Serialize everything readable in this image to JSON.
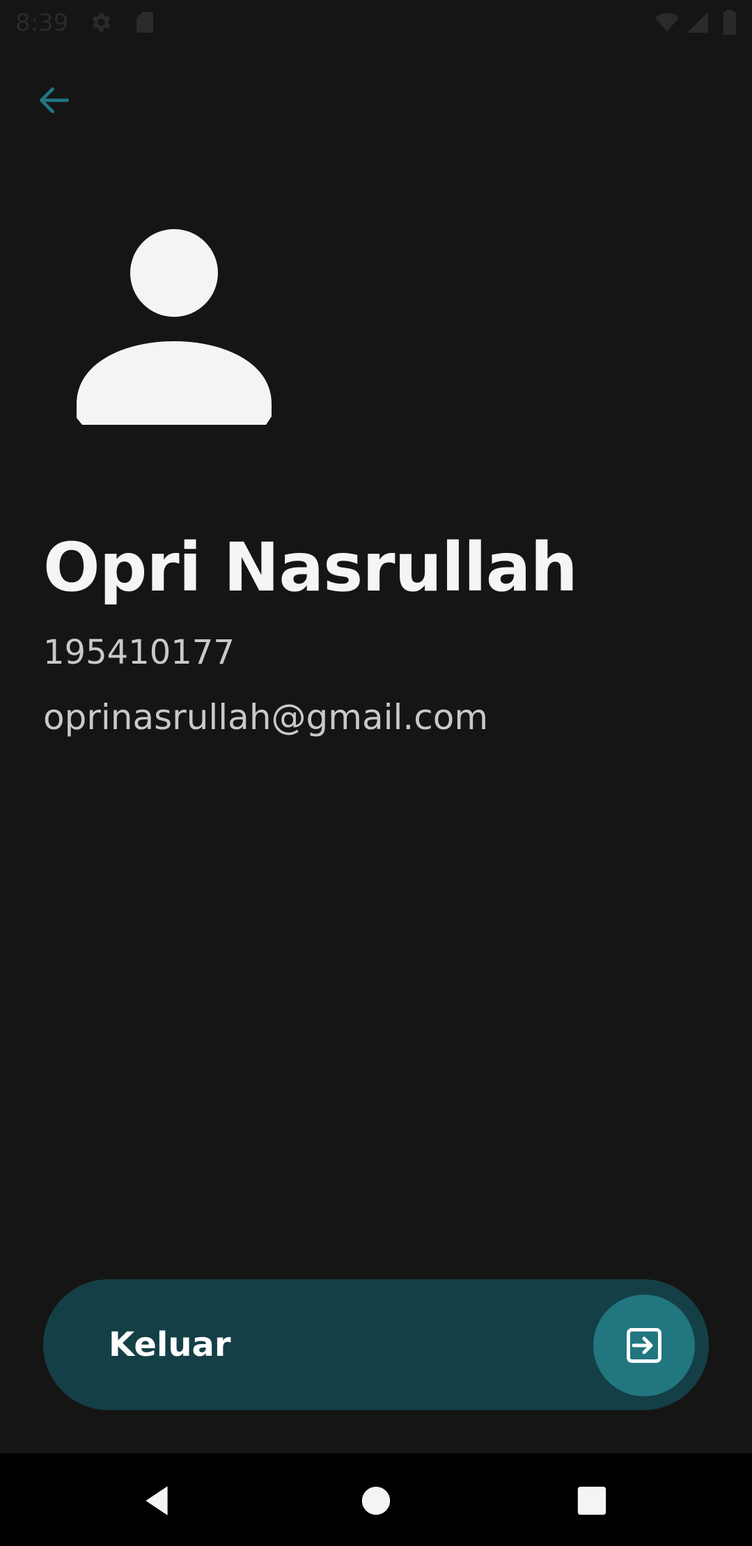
{
  "status_bar": {
    "time": "8:39",
    "icons": [
      "settings-icon",
      "sd-card-icon",
      "wifi-icon",
      "signal-icon",
      "battery-icon"
    ]
  },
  "header": {
    "back_icon": "arrow-left-icon"
  },
  "profile": {
    "avatar_icon": "person-icon",
    "name": "Opri Nasrullah",
    "nim": "195410177",
    "email": "oprinasrullah@gmail.com"
  },
  "logout": {
    "label": "Keluar",
    "icon": "login-exit-icon"
  },
  "nav_bar": {
    "icons": [
      "back-triangle-icon",
      "home-circle-icon",
      "recents-square-icon"
    ]
  },
  "colors": {
    "background": "#151515",
    "accent": "#217680",
    "button_bg": "#143f46",
    "back_arrow": "#217680",
    "text_primary": "#f5f5f5",
    "text_secondary": "#c9c9c9"
  }
}
